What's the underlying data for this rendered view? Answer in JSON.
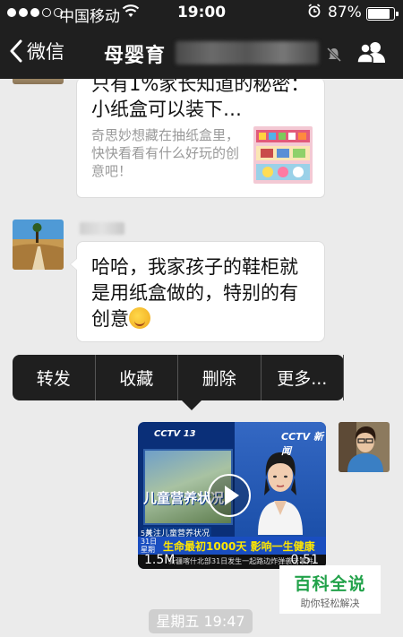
{
  "status_bar": {
    "carrier": "中国移动",
    "time": "19:00",
    "battery_percent": "87%",
    "battery_level": 0.87,
    "signal_bars_filled": 3,
    "signal_bars_total": 5
  },
  "nav": {
    "back_label": "微信",
    "title": "母婴育"
  },
  "messages": {
    "article": {
      "title": "只有1%家长知道的秘密：小纸盒可以装下…",
      "description": "奇思妙想藏在抽纸盒里，快快看看有什么好玩的创意吧！"
    },
    "reply": {
      "text": "哈哈，我家孩子的鞋柜就是用纸盒做的，特别的有创意"
    },
    "video": {
      "channel_logo": "CCTV 13",
      "channel_logo_right": "CCTV 新闻",
      "inset_caption": "儿童营养状况",
      "subcaption": "关注儿童营养状况",
      "ticker_date": "5月31日 星期四",
      "ticker_headline": "生命最初1000天 影响一生健康",
      "strip_text": "新疆喀什北部31日发生一起路边炸弹袭击事件",
      "file_size": "1.5M",
      "duration": "0:51"
    }
  },
  "context_menu": {
    "items": [
      "转发",
      "收藏",
      "删除",
      "更多..."
    ]
  },
  "timestamp": "星期五 19:47",
  "watermark": {
    "brand": "百科全说",
    "slogan": "助你轻松解决"
  },
  "colors": {
    "bar_bg": "#1f1f1f",
    "chat_bg": "#ebebeb",
    "watermark_green": "#22a24a"
  }
}
